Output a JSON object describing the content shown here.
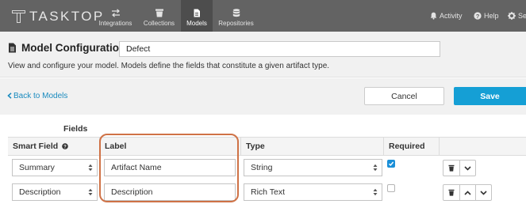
{
  "brand": {
    "logo_text": "TASKTOP"
  },
  "nav": {
    "items": [
      {
        "label": "Integrations",
        "icon": "swap-arrows-icon"
      },
      {
        "label": "Collections",
        "icon": "trash-bin-icon"
      },
      {
        "label": "Models",
        "icon": "document-icon",
        "active": true
      },
      {
        "label": "Repositories",
        "icon": "database-icon"
      }
    ]
  },
  "topright": {
    "activity": "Activity",
    "help": "Help",
    "settings": "Settings"
  },
  "header": {
    "title": "Model Configuration",
    "model_name": "Defect",
    "description": "View and configure your model. Models define the fields that constitute a given artifact type."
  },
  "actions": {
    "back": "Back to Models",
    "cancel": "Cancel",
    "save": "Save"
  },
  "fields": {
    "heading": "Fields",
    "columns": {
      "smart_field": "Smart Field",
      "label": "Label",
      "type": "Type",
      "required": "Required"
    },
    "rows": [
      {
        "smart_field": "Summary",
        "label": "Artifact Name",
        "type": "String",
        "required": true,
        "actions": [
          "delete",
          "down"
        ]
      },
      {
        "smart_field": "Description",
        "label": "Description",
        "type": "Rich Text",
        "required": false,
        "actions": [
          "delete",
          "up",
          "down"
        ]
      }
    ]
  },
  "colors": {
    "topbar": "#636363",
    "accent": "#159fd5",
    "link": "#1a8bbf",
    "highlight": "#cf7246"
  }
}
